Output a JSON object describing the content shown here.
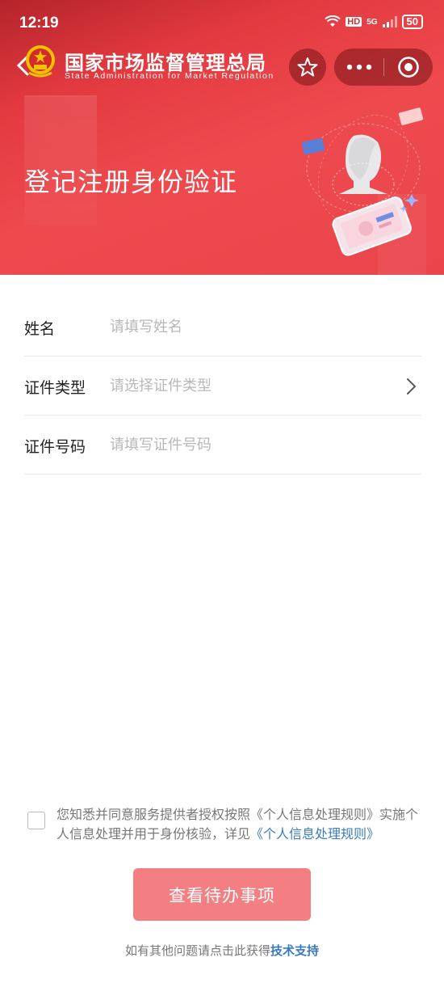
{
  "status_bar": {
    "time": "12:19",
    "network": "5G",
    "hd": "HD",
    "battery": "50"
  },
  "header": {
    "agency_name": "国家市场监督管理总局",
    "agency_name_en": "State Administration for Market Regulation",
    "banner_title": "登记注册身份验证"
  },
  "form": {
    "name": {
      "label": "姓名",
      "placeholder": "请填写姓名",
      "value": ""
    },
    "id_type": {
      "label": "证件类型",
      "placeholder": "请选择证件类型",
      "value": ""
    },
    "id_number": {
      "label": "证件号码",
      "placeholder": "请填写证件号码",
      "value": ""
    }
  },
  "agreement": {
    "checked": false,
    "text_part1": "您知悉并同意服务提供者授权按照《个人信息处理规则》实施个人信息处理并用于身份核验，详见",
    "link_text": "《个人信息处理规则》"
  },
  "submit_label": "查看待办事项",
  "help": {
    "text": "如有其他问题请点击此获得",
    "link_text": "技术支持"
  },
  "colors": {
    "brand_red": "#e2393f",
    "button_red": "#f47f82",
    "link_blue": "#3a7bbf"
  }
}
